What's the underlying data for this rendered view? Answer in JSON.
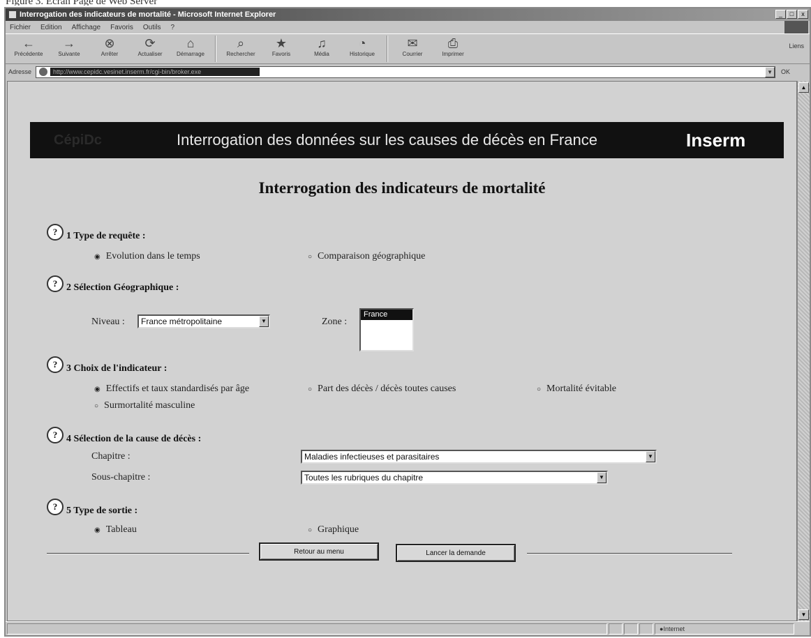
{
  "caption": "Figure 3. Ecran Page de Web Server",
  "window": {
    "title": "Interrogation des indicateurs de mortalité - Microsoft Internet Explorer",
    "controls": [
      "_",
      "□",
      "x"
    ]
  },
  "menu": [
    "Fichier",
    "Edition",
    "Affichage",
    "Favoris",
    "Outils",
    "?"
  ],
  "toolbar": [
    {
      "icon": "back-icon",
      "glyph": "←",
      "label": "Précédente"
    },
    {
      "icon": "forward-icon",
      "glyph": "→",
      "label": "Suivante"
    },
    {
      "icon": "stop-icon",
      "glyph": "⊗",
      "label": "Arrêter"
    },
    {
      "icon": "refresh-icon",
      "glyph": "⟳",
      "label": "Actualiser"
    },
    {
      "icon": "home-icon",
      "glyph": "⌂",
      "label": "Démarrage"
    },
    {
      "icon": "search-icon",
      "glyph": "⌕",
      "label": "Rechercher"
    },
    {
      "icon": "favorites-icon",
      "glyph": "★",
      "label": "Favoris"
    },
    {
      "icon": "media-icon",
      "glyph": "♫",
      "label": "Média"
    },
    {
      "icon": "history-icon",
      "glyph": "◔",
      "label": "Historique"
    },
    {
      "icon": "mail-icon",
      "glyph": "✉",
      "label": "Courrier"
    },
    {
      "icon": "print-icon",
      "glyph": "⎙",
      "label": "Imprimer"
    }
  ],
  "links_label": "Liens",
  "address": {
    "label": "Adresse",
    "url": "http://www.cepidc.vesinet.inserm.fr/cgi-bin/broker.exe",
    "go": "OK"
  },
  "banner": {
    "logo": "CépiDc",
    "title": "Interrogation des données sur les causes de décès en France",
    "brand": "Inserm"
  },
  "page_title": "Interrogation des indicateurs de mortalité",
  "help_glyph": "?",
  "sections": {
    "s1": {
      "label": "1 Type de requête :",
      "options": [
        "Evolution dans le temps",
        "Comparaison géographique"
      ]
    },
    "s2": {
      "label": "2 Sélection Géographique :",
      "niveau_label": "Niveau :",
      "niveau_value": "France métropolitaine",
      "zone_label": "Zone :",
      "zone_selected": "France"
    },
    "s3": {
      "label": "3 Choix de l'indicateur :",
      "options": [
        "Effectifs et taux standardisés par âge",
        "Part des décès / décès toutes causes",
        "Mortalité évitable",
        "Surmortalité masculine"
      ]
    },
    "s4": {
      "label": "4 Sélection de la cause de décès :",
      "chapitre_label": "Chapitre :",
      "chapitre_value": "Maladies infectieuses et parasitaires",
      "souschapitre_label": "Sous-chapitre :",
      "souschapitre_value": "Toutes les rubriques du chapitre"
    },
    "s5": {
      "label": "5 Type de sortie :",
      "options": [
        "Tableau",
        "Graphique"
      ]
    }
  },
  "radio_selected": "◉",
  "radio_unselected": "○",
  "dropdown_glyph": "▼",
  "buttons": {
    "back": "Retour au menu",
    "submit": "Lancer la demande"
  },
  "status": {
    "zone": "Internet"
  }
}
